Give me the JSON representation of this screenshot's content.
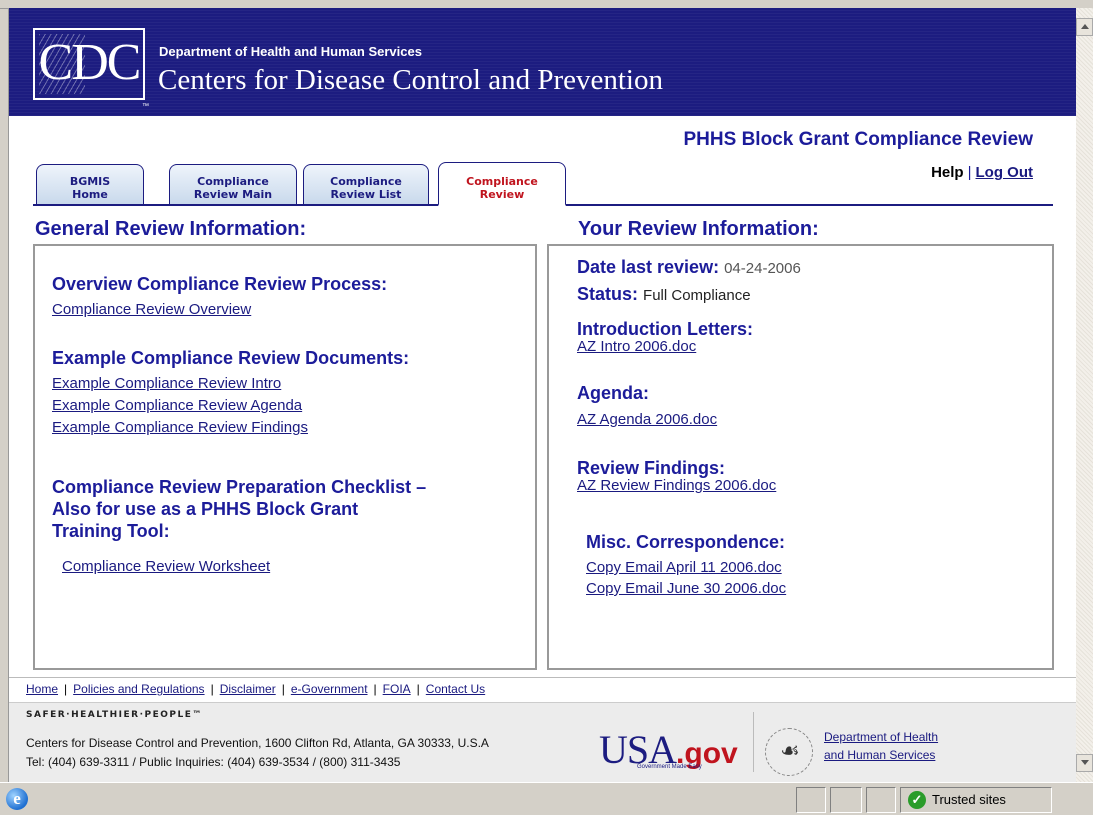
{
  "header": {
    "logo_text": "CDC",
    "department": "Department of Health and Human Services",
    "agency": "Centers for Disease Control and Prevention"
  },
  "app_title": "PHHS Block Grant Compliance Review",
  "help_links": {
    "help": "Help",
    "separator": "|",
    "logout": "Log Out"
  },
  "tabs": [
    {
      "line1": "BGMIS",
      "line2": "Home",
      "active": false
    },
    {
      "line1": "Compliance",
      "line2": "Review Main",
      "active": false
    },
    {
      "line1": "Compliance",
      "line2": "Review List",
      "active": false
    },
    {
      "line1": "Compliance",
      "line2": "Review",
      "active": true
    }
  ],
  "general": {
    "heading": "General Review Information:",
    "overview_heading": "Overview Compliance Review Process:",
    "overview_link": "Compliance Review Overview",
    "examples_heading": "Example Compliance Review Documents:",
    "example_links": [
      "Example Compliance Review Intro",
      "Example Compliance Review Agenda",
      "Example Compliance Review Findings"
    ],
    "checklist_heading_1": "Compliance Review Preparation Checklist –",
    "checklist_heading_2": "Also for use as a PHHS Block Grant",
    "checklist_heading_3": "Training Tool:",
    "worksheet_link": "Compliance Review Worksheet"
  },
  "review": {
    "heading": "Your Review Information:",
    "date_label": "Date last review:",
    "date_value": "04-24-2006",
    "status_label": "Status:",
    "status_value": "Full Compliance",
    "intro_heading": "Introduction Letters:",
    "intro_link": "AZ Intro 2006.doc",
    "agenda_heading": "Agenda:",
    "agenda_link": "AZ Agenda 2006.doc",
    "findings_heading": "Review Findings:",
    "findings_link": "AZ Review Findings 2006.doc",
    "misc_heading": "Misc. Correspondence:",
    "misc_links": [
      "Copy Email April 11 2006.doc",
      "Copy Email June 30 2006.doc"
    ]
  },
  "footer": {
    "links": [
      "Home",
      "Policies and Regulations",
      "Disclaimer",
      "e-Government",
      "FOIA",
      "Contact Us"
    ],
    "separator": "|",
    "slogan": "SAFER·HEALTHIER·PEOPLE™",
    "address": "Centers for Disease Control and Prevention, 1600 Clifton Rd, Atlanta, GA 30333, U.S.A",
    "phone": "Tel: (404) 639-3311 / Public Inquiries: (404) 639-3534 / (800) 311-3435",
    "usagov_main": "USA",
    "usagov_suffix": ".gov",
    "usagov_tagline": "Government Made Easy",
    "hhs_link_1": "Department of Health",
    "hhs_link_2": "and Human Services"
  },
  "statusbar": {
    "zone": "Trusted sites"
  },
  "colors": {
    "header_bg": "#1c1c80",
    "heading": "#1c1c9a",
    "active_tab": "#c0141e"
  }
}
